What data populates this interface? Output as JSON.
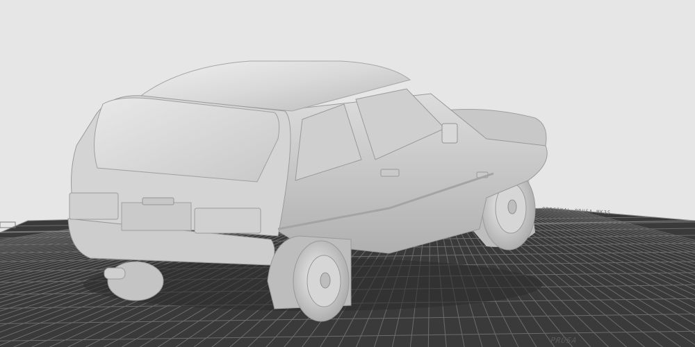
{
  "scene": {
    "model_name": "car-model",
    "background_color": "#e6e6e6",
    "bed_color": "#3a3a3a",
    "grid_color": "#6c6c6c",
    "model_color": "#d9d9d9"
  },
  "bed": {
    "label_right": "PRUSA",
    "label_top": "ORIGINAL PRUSA MK3S"
  }
}
